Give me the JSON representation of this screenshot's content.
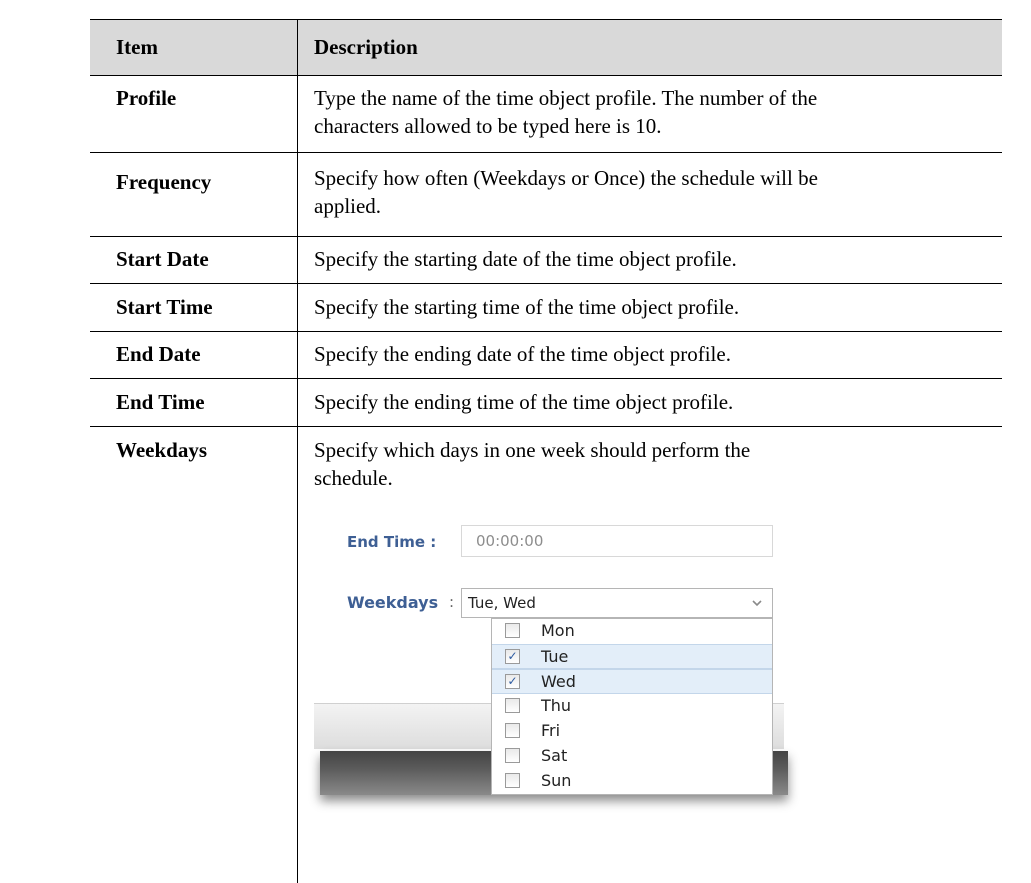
{
  "table": {
    "headers": {
      "item": "Item",
      "description": "Description"
    },
    "rows": [
      {
        "item": "Profile",
        "lines": [
          "Type the name of the time object profile. The number of the",
          "characters allowed to be typed here is 10."
        ]
      },
      {
        "item": "Frequency",
        "lines": [
          "Specify how often (Weekdays or Once) the schedule will be",
          "applied."
        ]
      },
      {
        "item": "Start Date",
        "lines": [
          "Specify the starting date of the time object profile."
        ]
      },
      {
        "item": "Start Time",
        "lines": [
          "Specify the starting time of the time object profile."
        ]
      },
      {
        "item": "End Date",
        "lines": [
          "Specify the ending date of the time object profile."
        ]
      },
      {
        "item": "End Time",
        "lines": [
          "Specify the ending time of the time object profile."
        ]
      },
      {
        "item": "Weekdays",
        "lines": [
          "Specify which days in one week should perform the",
          "schedule."
        ]
      }
    ]
  },
  "screenshot": {
    "end_time_label": "End Time :",
    "end_time_value": "00:00:00",
    "weekdays_label": "Weekdays",
    "weekdays_colon": ":",
    "weekdays_value": "Tue, Wed",
    "dropdown_icon": "chevron-down-icon",
    "options": [
      {
        "label": "Mon",
        "checked": false
      },
      {
        "label": "Tue",
        "checked": true
      },
      {
        "label": "Wed",
        "checked": true
      },
      {
        "label": "Thu",
        "checked": false
      },
      {
        "label": "Fri",
        "checked": false
      },
      {
        "label": "Sat",
        "checked": false
      },
      {
        "label": "Sun",
        "checked": false
      }
    ],
    "colors": {
      "label": "#3e5f94",
      "selected_row": "#e3eef9",
      "check": "#2d5aa0"
    }
  }
}
